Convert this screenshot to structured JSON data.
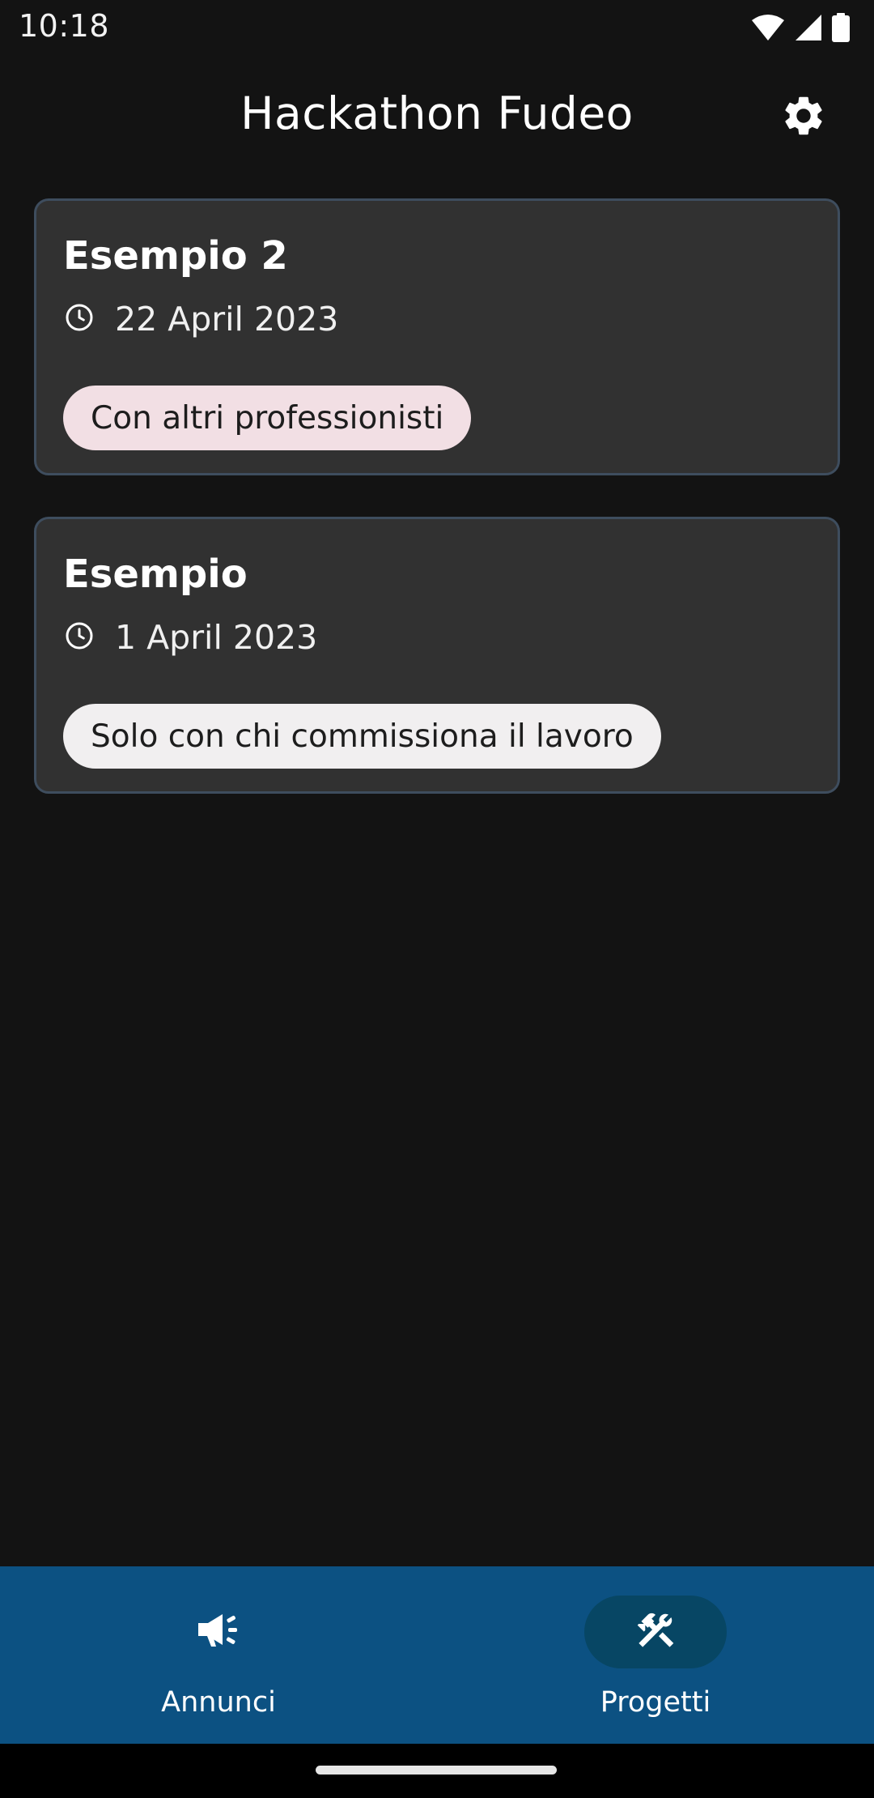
{
  "status_bar": {
    "time": "10:18",
    "icons": [
      "wifi-icon",
      "signal-icon",
      "battery-icon"
    ]
  },
  "app_bar": {
    "title": "Hackathon Fudeo",
    "settings_icon": "gear-icon"
  },
  "projects": [
    {
      "title": "Esempio 2",
      "date": "22 April 2023",
      "tag": "Con altri professionisti",
      "tag_color": "#f2dfe4"
    },
    {
      "title": "Esempio",
      "date": "1 April 2023",
      "tag": "Solo con chi commissiona il lavoro",
      "tag_color": "#f1eff0"
    }
  ],
  "bottom_nav": {
    "items": [
      {
        "label": "Annunci",
        "icon": "megaphone-icon",
        "active": false
      },
      {
        "label": "Progetti",
        "icon": "tools-icon",
        "active": true
      }
    ]
  },
  "colors": {
    "background": "#131313",
    "card": "#313131",
    "card_border": "#3e4d5e",
    "nav_bar": "#0c5182",
    "nav_active_indicator": "#074664"
  }
}
